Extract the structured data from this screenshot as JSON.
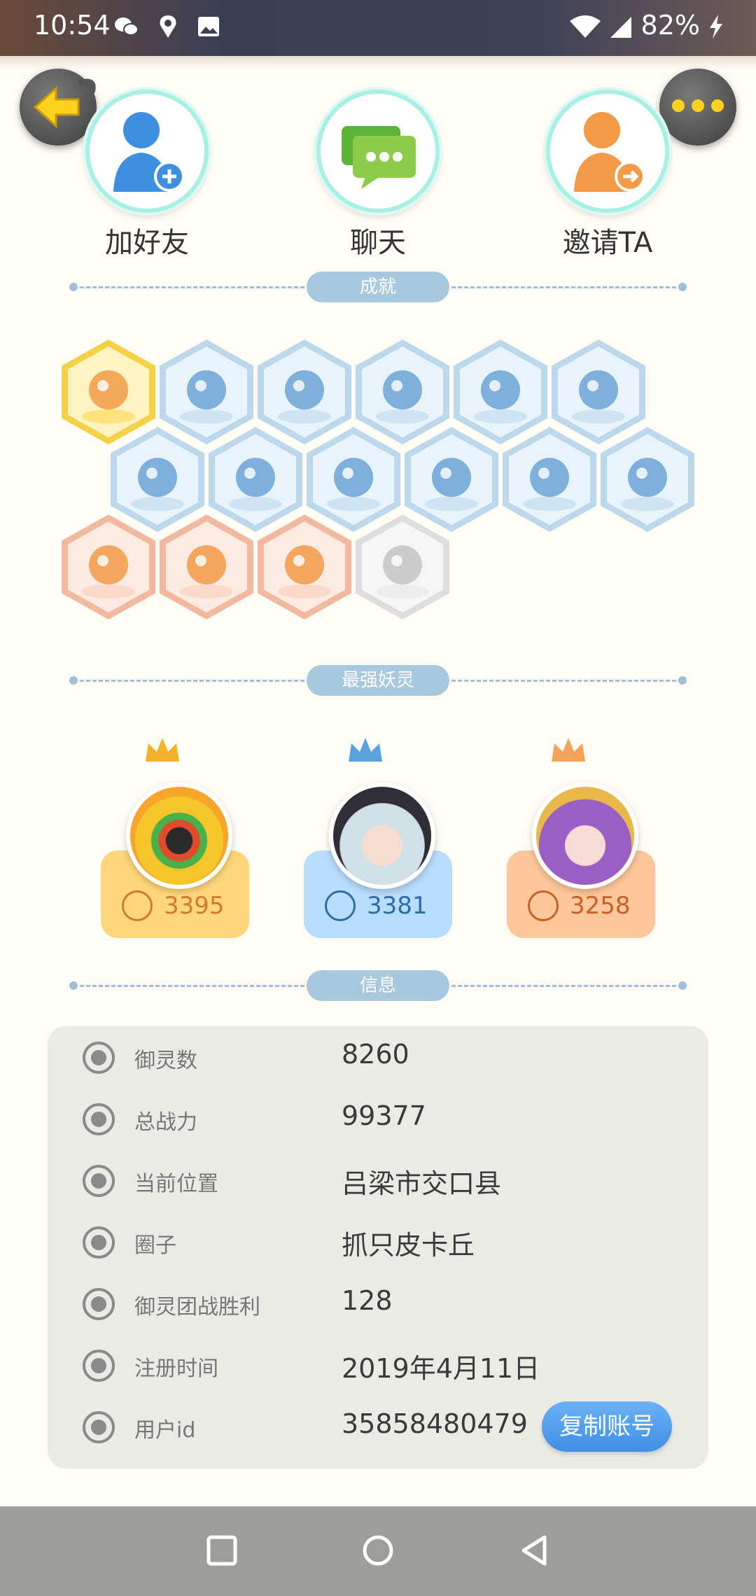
{
  "status_bar": {
    "time": "10:54",
    "battery": "82%"
  },
  "actions": [
    {
      "label": "加好友",
      "icon": "add-friend-icon"
    },
    {
      "label": "聊天",
      "icon": "chat-icon"
    },
    {
      "label": "邀请TA",
      "icon": "invite-icon"
    }
  ],
  "sections": {
    "achievements": "成就",
    "strongest": "最强妖灵",
    "info": "信息"
  },
  "achievements": [
    {
      "color": "#ffe27a",
      "icon": "fox-badge-icon",
      "state": "gold"
    },
    {
      "color": "#cfe4f2",
      "icon": "sneaker-badge-icon",
      "state": "blue"
    },
    {
      "color": "#cfe4f2",
      "icon": "magnifier-badge-icon",
      "state": "blue"
    },
    {
      "color": "#cfe4f2",
      "icon": "moon-badge-icon",
      "state": "blue"
    },
    {
      "color": "#cfe4f2",
      "icon": "orb-badge-icon",
      "state": "blue"
    },
    {
      "color": "#cfe4f2",
      "icon": "crystal-badge-icon",
      "state": "blue"
    },
    {
      "color": "#cfe4f2",
      "icon": "yinyang-wave-badge-icon",
      "state": "blue"
    },
    {
      "color": "#cfe4f2",
      "icon": "creature-badge-icon",
      "state": "blue"
    },
    {
      "color": "#cfe4f2",
      "icon": "cat-badge-icon",
      "state": "blue"
    },
    {
      "color": "#cfe4f2",
      "icon": "yinyang-badge-icon",
      "state": "blue"
    },
    {
      "color": "#cfe4f2",
      "icon": "horned-badge-icon",
      "state": "blue"
    },
    {
      "color": "#cfe4f2",
      "icon": "ghost-badge-icon",
      "state": "blue"
    },
    {
      "color": "#fbd9c8",
      "icon": "cart-badge-icon",
      "state": "orange"
    },
    {
      "color": "#fbd9c8",
      "icon": "koi-badge-icon",
      "state": "orange"
    },
    {
      "color": "#fbd9c8",
      "icon": "shield-badge-icon",
      "state": "orange"
    },
    {
      "color": "#ececec",
      "icon": "book-badge-icon",
      "state": "locked"
    }
  ],
  "top_lings": [
    {
      "power": "3395",
      "card_color": "#ffd77a",
      "text_color": "#d07a2a",
      "crown_color": "#f4b22a",
      "portrait": "gold-ling-portrait"
    },
    {
      "power": "3381",
      "card_color": "#b9ddfc",
      "text_color": "#2c6ea8",
      "crown_color": "#5aa2dc",
      "portrait": "blue-ling-portrait"
    },
    {
      "power": "3258",
      "card_color": "#ffc79a",
      "text_color": "#c9602a",
      "crown_color": "#f4a15a",
      "portrait": "orange-ling-portrait"
    }
  ],
  "info_rows": [
    {
      "key": "御灵数",
      "value": "8260",
      "icon": "spirit-count-icon"
    },
    {
      "key": "总战力",
      "value": "99377",
      "icon": "sword-icon"
    },
    {
      "key": "当前位置",
      "value": "吕梁市交口县",
      "icon": "location-icon"
    },
    {
      "key": "圈子",
      "value": "抓只皮卡丘",
      "icon": "circle-icon"
    },
    {
      "key": "御灵团战胜利",
      "value": "128",
      "icon": "victory-icon"
    },
    {
      "key": "注册时间",
      "value": "2019年4月11日",
      "icon": "clock-icon"
    },
    {
      "key": "用户id",
      "value": "35858480479",
      "icon": "id-card-icon"
    }
  ],
  "copy_button": "复制账号"
}
